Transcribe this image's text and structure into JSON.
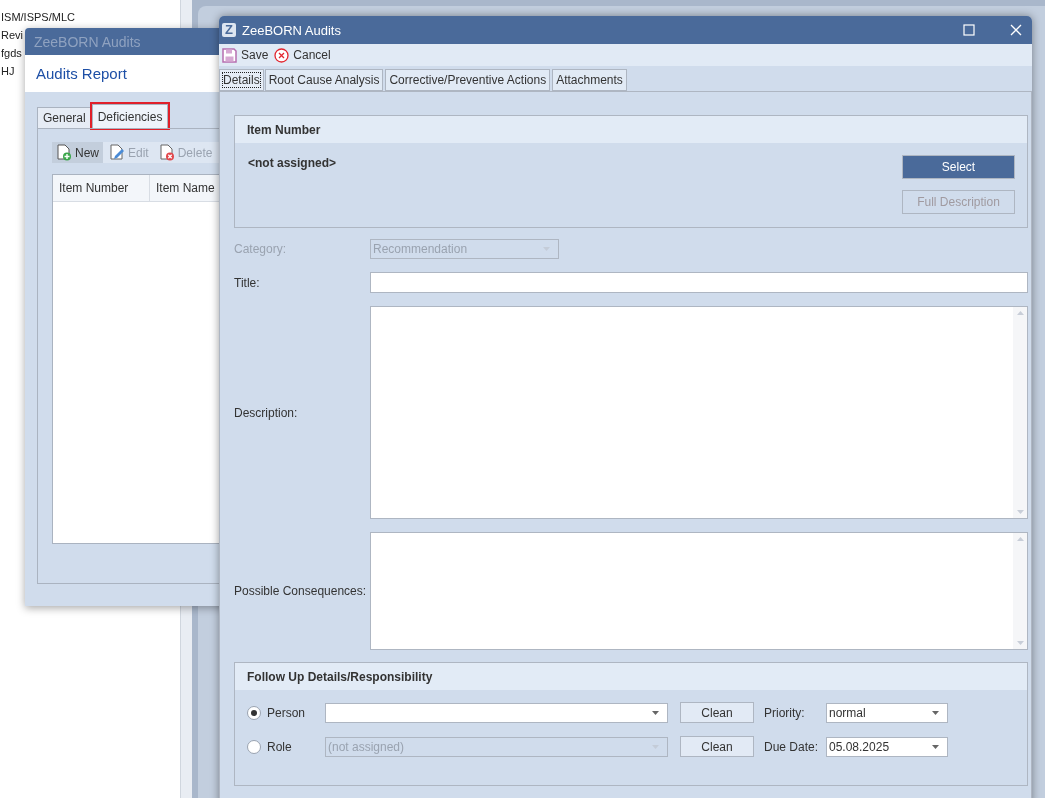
{
  "background_list": {
    "items": [
      "ISM/ISPS/MLC",
      "Revi",
      "fgds",
      "HJ"
    ]
  },
  "back_window": {
    "title": "ZeeBORN Audits",
    "active": false,
    "header": "Audits Report",
    "tabs": [
      {
        "label": "General",
        "selected": false,
        "highlighted": false
      },
      {
        "label": "Deficiencies",
        "selected": true,
        "highlighted": true
      }
    ],
    "toolbar": [
      {
        "kind": "new",
        "label": "New",
        "disabled": false,
        "hovered": true
      },
      {
        "kind": "edit",
        "label": "Edit",
        "disabled": true,
        "hovered": false
      },
      {
        "kind": "delete",
        "label": "Delete",
        "disabled": true,
        "hovered": false
      }
    ],
    "table": {
      "columns": [
        "Item Number",
        "Item Name"
      ]
    }
  },
  "dialog": {
    "logo": "Z",
    "title": "ZeeBORN Audits",
    "active": true,
    "toolbar": [
      {
        "kind": "save",
        "label": "Save"
      },
      {
        "kind": "cancel",
        "label": "Cancel"
      }
    ],
    "tabs": [
      {
        "label": "Details",
        "selected": true
      },
      {
        "label": "Root Cause Analysis",
        "selected": false
      },
      {
        "label": "Corrective/Preventive Actions",
        "selected": false
      },
      {
        "label": "Attachments",
        "selected": false
      }
    ],
    "item_number": {
      "heading": "Item Number",
      "value": "<not assigned>",
      "buttons": [
        {
          "label": "Select",
          "primary": true,
          "disabled": false
        },
        {
          "label": "Full Description",
          "primary": false,
          "disabled": true
        }
      ]
    },
    "fields": [
      {
        "kind": "combo",
        "label": "Category:",
        "value": "Recommendation",
        "disabled": true
      },
      {
        "kind": "text",
        "label": "Title:",
        "disabled": false
      },
      {
        "kind": "memo",
        "label": "Description:",
        "disabled": false
      },
      {
        "kind": "memo",
        "label": "Possible Consequences:",
        "disabled": false
      }
    ],
    "follow_up": {
      "heading": "Follow Up Details/Responsibility",
      "rows": [
        {
          "option": "Person",
          "selected": true,
          "disabled": false,
          "clean": "Clean",
          "side_label": "Priority:",
          "side_value": "normal"
        },
        {
          "option": "Role",
          "selected": false,
          "value": "(not assigned)",
          "disabled": true,
          "clean": "Clean",
          "side_label": "Due Date:",
          "side_value": "05.08.2025"
        }
      ]
    }
  }
}
